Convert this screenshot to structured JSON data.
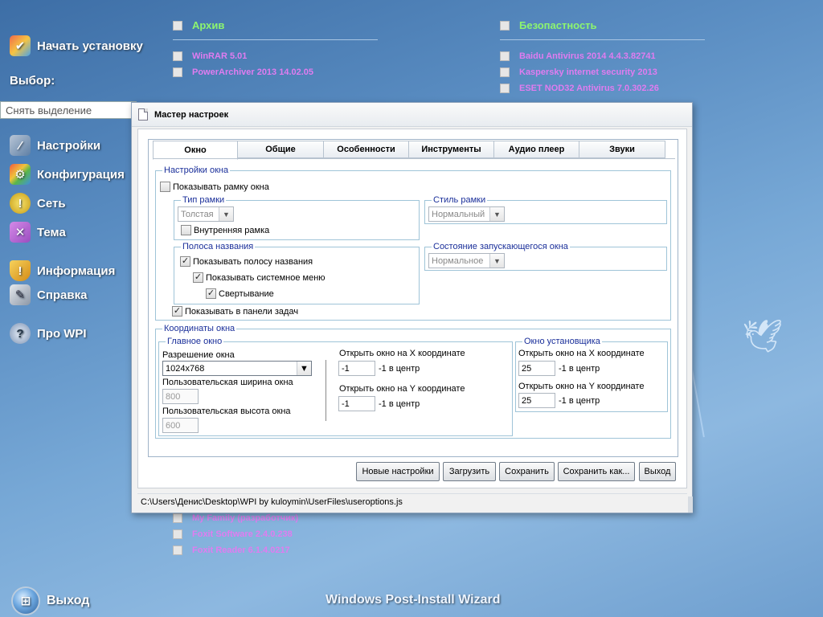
{
  "background": {
    "menu": {
      "start_install": "Начать установку",
      "choice_label": "Выбор:",
      "deselect": "Снять выделение",
      "items": [
        {
          "label": "Настройки",
          "icon": "settings-icon"
        },
        {
          "label": "Конфигурация",
          "icon": "configuration-icon"
        },
        {
          "label": "Сеть",
          "icon": "network-icon"
        },
        {
          "label": "Тема",
          "icon": "theme-icon"
        },
        {
          "label": "Информация",
          "icon": "info-icon"
        },
        {
          "label": "Справка",
          "icon": "help-icon"
        },
        {
          "label": "Про WPI",
          "icon": "about-icon"
        }
      ],
      "exit": "Выход"
    },
    "columns": {
      "archive": {
        "header": "Архив",
        "items": [
          "WinRAR 5.01",
          "PowerArchiver 2013 14.02.05"
        ]
      },
      "security": {
        "header": "Безопастность",
        "items": [
          "Baidu Antivirus 2014 4.4.3.82741",
          "Kaspersky internet security 2013",
          "ESET NOD32 Antivirus 7.0.302.26"
        ]
      },
      "bottom_items": [
        "My Family (разработчик)",
        "Foxit Software 2.4.0.238",
        "Foxit Reader 6.1.4.0217"
      ]
    },
    "footer_title": "Windows Post-Install Wizard",
    "colors": {
      "accent_green": "#8df56f",
      "item_pink": "#e07cf0"
    }
  },
  "dialog": {
    "title": "Мастер настроек",
    "tabs": [
      "Окно",
      "Общие",
      "Особенности",
      "Инструменты",
      "Аудио плеер",
      "Звуки"
    ],
    "active_tab": "Окно",
    "window_settings": {
      "legend": "Настройки окна",
      "show_frame": "Показывать рамку окна",
      "frame_type": {
        "legend": "Тип рамки",
        "value": "Толстая",
        "inner_frame": "Внутренняя рамка"
      },
      "frame_style": {
        "legend": "Стиль рамки",
        "value": "Нормальный"
      },
      "title_bar": {
        "legend": "Полоса названия",
        "show_title_bar": "Показывать полосу названия",
        "show_system_menu": "Показывать системное меню",
        "minimize": "Свертывание"
      },
      "launch_state": {
        "legend": "Состояние запускающегося окна",
        "value": "Нормальное"
      },
      "show_in_taskbar": "Показывать в панели задач"
    },
    "coordinates": {
      "legend": "Координаты окна",
      "main_window": {
        "legend": "Главное окно",
        "resolution_label": "Разрешение окна",
        "resolution_value": "1024x768",
        "custom_width_label": "Пользовательская ширина окна",
        "custom_width_value": "800",
        "custom_height_label": "Пользовательская высота окна",
        "custom_height_value": "600",
        "open_x_label": "Открыть окно на X координате",
        "open_x_value": "-1",
        "open_x_hint": "-1 в центр",
        "open_y_label": "Открыть окно на Y координате",
        "open_y_value": "-1",
        "open_y_hint": "-1 в центр"
      },
      "installer_window": {
        "legend": "Окно установщика",
        "open_x_label": "Открыть окно на X координате",
        "open_x_value": "25",
        "open_x_hint": "-1 в центр",
        "open_y_label": "Открыть окно на Y координате",
        "open_y_value": "25",
        "open_y_hint": "-1 в центр"
      }
    },
    "buttons": {
      "new_settings": "Новые настройки",
      "load": "Загрузить",
      "save": "Сохранить",
      "save_as": "Сохранить как...",
      "exit": "Выход"
    },
    "status_path": "C:\\Users\\Денис\\Desktop\\WPI by kuloymin\\UserFiles\\useroptions.js"
  }
}
